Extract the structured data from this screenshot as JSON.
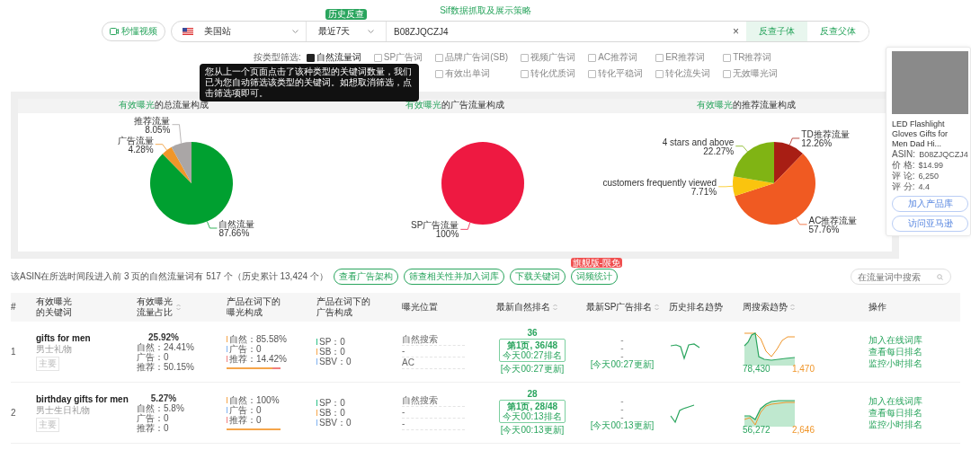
{
  "title": "Sif数据抓取及展示策略",
  "search": {
    "video_button": "秒懂视频",
    "site": "美国站",
    "period": "最近7天",
    "history_badge": "历史反查",
    "value": "B08ZJQCZJ4",
    "clear": "×",
    "buttons": [
      {
        "label": "反查子体",
        "selected": true
      },
      {
        "label": "反查父体",
        "selected": false
      }
    ]
  },
  "filters": {
    "label": "按类型筛选:",
    "options": [
      {
        "label": "自然流量词",
        "checked": true
      },
      {
        "label": "SP广告词",
        "checked": false
      },
      {
        "label": "品牌广告词(SB)",
        "checked": false
      },
      {
        "label": "视频广告词",
        "checked": false
      },
      {
        "label": "AC推荐词",
        "checked": false
      },
      {
        "label": "ER推荐词",
        "checked": false
      },
      {
        "label": "TR推荐词",
        "checked": false
      },
      {
        "label": "有效出单词",
        "checked": false
      },
      {
        "label": "转化优质词",
        "checked": false
      },
      {
        "label": "转化平稳词",
        "checked": false
      },
      {
        "label": "转化流失词",
        "checked": false
      },
      {
        "label": "无效曝光词",
        "checked": false
      }
    ],
    "tooltip": "您从上一个页面点击了该种类型的关键词数量，我们已为您自动筛选该类型的关键词。如想取消筛选，点击筛选项即可。"
  },
  "charts": [
    {
      "title_highlight": "有效曝光",
      "title_rest": "的总流量构成",
      "slices": [
        {
          "color": "#00a030"
        },
        {
          "color": "#f0962a"
        },
        {
          "color": "#aaa6a6"
        }
      ],
      "chart_data": {
        "type": "pie",
        "categories": [
          "自然流量",
          "广告流量",
          "推荐流量"
        ],
        "values": [
          87.66,
          4.28,
          8.05
        ],
        "value_labels": [
          "87.66%",
          "4.28%",
          "8.05%"
        ]
      }
    },
    {
      "title_highlight": "有效曝光",
      "title_rest": "的广告流量构成",
      "slices": [
        {
          "color": "#ee1941"
        }
      ],
      "chart_data": {
        "type": "pie",
        "categories": [
          "SP广告流量"
        ],
        "values": [
          100
        ],
        "value_labels": [
          "100%"
        ]
      }
    },
    {
      "title_highlight": "有效曝光",
      "title_rest": "的推荐流量构成",
      "slices": [
        {
          "color": "#a81e14"
        },
        {
          "color": "#f05a22"
        },
        {
          "color": "#fac40e"
        },
        {
          "color": "#80b414"
        }
      ],
      "chart_data": {
        "type": "pie",
        "categories": [
          "TD推荐流量",
          "AC推荐流量",
          "customers frequently viewed",
          "4 stars and above"
        ],
        "values": [
          12.26,
          57.76,
          7.71,
          22.27
        ],
        "value_labels": [
          "12.26%",
          "57.76%",
          "7.71%",
          "22.27%"
        ]
      }
    }
  ],
  "summary": {
    "text": "该ASIN在所选时间段进入前 3 页的自然流量词有 517 个（历史累计 13,424 个）",
    "buttons": [
      {
        "label": "查看广告架构"
      },
      {
        "label": "筛查相关性并加入词库"
      },
      {
        "label": "下载关键词"
      },
      {
        "label": "词频统计",
        "badge": "旗舰版-限免"
      }
    ],
    "search_placeholder": "在流量词中搜索"
  },
  "table": {
    "columns": [
      {
        "label": "#",
        "sortable": false
      },
      {
        "label": "有效曝光的关键词",
        "sortable": false
      },
      {
        "label": "有效曝光流量占比",
        "sortable": true
      },
      {
        "label": "产品在词下的曝光构成",
        "sortable": false
      },
      {
        "label": "产品在词下的广告构成",
        "sortable": false
      },
      {
        "label": "曝光位置",
        "sortable": false
      },
      {
        "label": "最新自然排名",
        "sortable": true
      },
      {
        "label": "最新SP广告排名",
        "sortable": true
      },
      {
        "label": "历史排名趋势",
        "sortable": false
      },
      {
        "label": "周搜索趋势",
        "sortable": true
      },
      {
        "label": "操作",
        "sortable": false
      }
    ],
    "rows": [
      {
        "index": "1",
        "keyword": "gifts for men",
        "translation": "男士礼物",
        "tag": "主要",
        "share": "25.92%",
        "share_parts": [
          "自然：24.41%",
          "广告：0",
          "推荐：50.15%"
        ],
        "exposure": [
          {
            "text": "自然：85.58%",
            "color": "#f5a54a"
          },
          {
            "text": "广告：0",
            "color": "#7fb2f0"
          },
          {
            "text": "推荐：14.42%",
            "color": "#f07f7f"
          }
        ],
        "exposure_bar": [
          {
            "color": "#f5a54a",
            "level": 0.8558
          },
          {
            "color": "#f07f7f",
            "level": 0.1442
          }
        ],
        "ads": [
          {
            "text": "SP：0",
            "color": "#2bbf86"
          },
          {
            "text": "SB：0",
            "color": "#f5a54a"
          },
          {
            "text": "SBV：0",
            "color": "#7fb2f0"
          }
        ],
        "positions": [
          "自然搜索",
          "-",
          "AC"
        ],
        "rank": {
          "value": "36",
          "page": "第1页, 36/48",
          "time": "今天00:27排名",
          "updated": "[今天00:27更新]"
        },
        "sp_rank": {
          "values": [
            "-",
            "-",
            "-"
          ],
          "updated": "[今天00:27更新]"
        },
        "search_volume": "78,430",
        "rank_value": "1,470",
        "actions": [
          "加入在线词库",
          "查看每日排名",
          "监控小时排名"
        ]
      },
      {
        "index": "2",
        "keyword": "birthday gifts for men",
        "translation": "男士生日礼物",
        "tag": "主要",
        "share": "5.27%",
        "share_parts": [
          "自然：5.8%",
          "广告：0",
          "推荐：0"
        ],
        "exposure": [
          {
            "text": "自然：100%",
            "color": "#f5a54a"
          },
          {
            "text": "广告：0",
            "color": "#7fb2f0"
          },
          {
            "text": "推荐：0",
            "color": "#f07f7f"
          }
        ],
        "exposure_bar": [
          {
            "color": "#f5a54a",
            "level": 1
          }
        ],
        "ads": [
          {
            "text": "SP：0",
            "color": "#2bbf86"
          },
          {
            "text": "SB：0",
            "color": "#f5a54a"
          },
          {
            "text": "SBV：0",
            "color": "#7fb2f0"
          }
        ],
        "positions": [
          "自然搜索",
          "-",
          "-"
        ],
        "rank": {
          "value": "28",
          "page": "第1页, 28/48",
          "time": "今天00:13排名",
          "updated": "[今天00:13更新]"
        },
        "sp_rank": {
          "values": [
            "-",
            "-",
            "-"
          ],
          "updated": "[今天00:13更新]"
        },
        "search_volume": "56,272",
        "rank_value": "2,646",
        "actions": [
          "加入在线词库",
          "查看每日排名",
          "监控小时排名"
        ]
      }
    ]
  },
  "product": {
    "title": "LED Flashlight Gloves Gifts for Men Dad Hi...",
    "fields": [
      {
        "label": "ASIN:",
        "value": "B08ZJQCZJ4"
      },
      {
        "label": "价 格:",
        "value": "$14.99"
      },
      {
        "label": "评 论:",
        "value": "6,250"
      },
      {
        "label": "评 分:",
        "value": "4.4"
      }
    ],
    "buttons": [
      "加入产品库",
      "访问亚马逊"
    ]
  }
}
